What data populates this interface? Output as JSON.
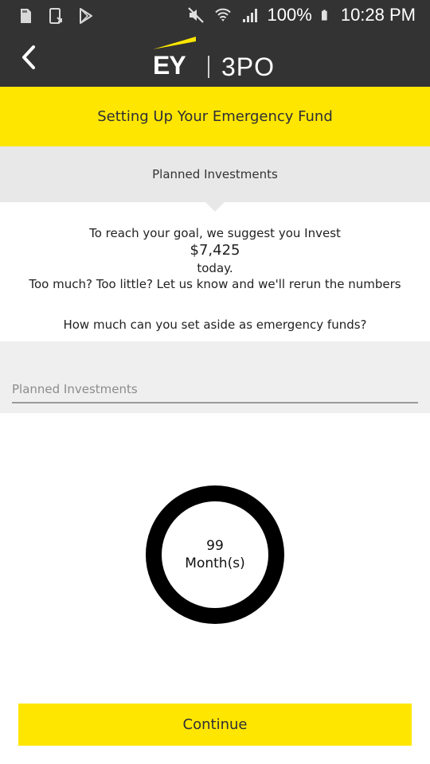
{
  "status_bar": {
    "battery": "100%",
    "time": "10:28 PM"
  },
  "header": {
    "logo_left": "EY",
    "logo_right": "3PO",
    "back_icon": "chevron-left-icon"
  },
  "banner": {
    "title": "Setting Up Your Emergency Fund"
  },
  "section": {
    "tab_label": "Planned Investments"
  },
  "suggestion": {
    "line1": "To reach your goal, we suggest you Invest",
    "amount": "$7,425",
    "line3": "today.",
    "line4": "Too much? Too little? Let us know and we'll rerun the numbers"
  },
  "question": {
    "text": "How much can you set aside as emergency funds?"
  },
  "input": {
    "placeholder": "Planned Investments",
    "value": ""
  },
  "progress": {
    "value": "99",
    "unit": "Month(s)"
  },
  "actions": {
    "continue_label": "Continue"
  },
  "colors": {
    "brand_yellow": "#ffe600",
    "header_dark": "#333333",
    "panel_gray": "#e8e8e8"
  }
}
